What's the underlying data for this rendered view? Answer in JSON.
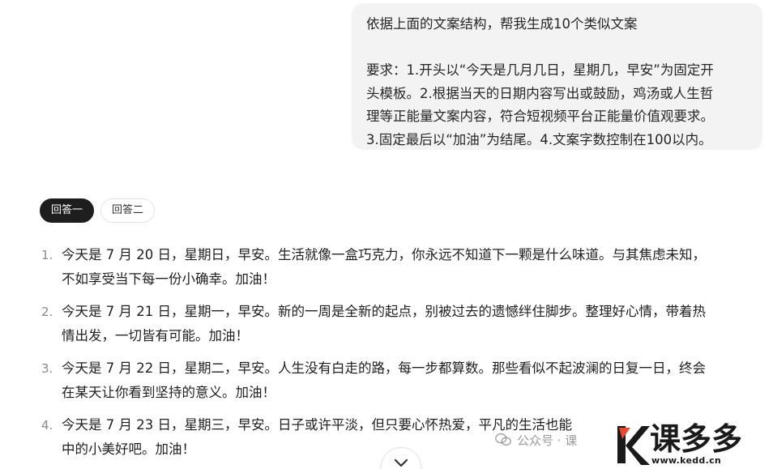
{
  "user_message": {
    "line1": "依据上面的文案结构，帮我生成10个类似文案",
    "line2": "要求：1.开头以“今天是几月几日，星期几，早安”为固定开",
    "line3": "头模板。2.根据当天的日期内容写出或鼓励，鸡汤或人生哲",
    "line4": "理等正能量文案内容，符合短视频平台正能量价值观要求。",
    "line5": "3.固定最后以“加油”为结尾。4.文案字数控制在100以内。"
  },
  "tabs": [
    {
      "label": "回答一",
      "active": true
    },
    {
      "label": "回答二",
      "active": false
    }
  ],
  "answers": [
    {
      "num": "1.",
      "line1": "今天是 7 月 20 日，星期日，早安。生活就像一盒巧克力，你永远不知道下一颗是什么味道。与其焦虑未知，",
      "line2": "不如享受当下每一份小确幸。加油！"
    },
    {
      "num": "2.",
      "line1": "今天是 7 月 21 日，星期一，早安。新的一周是全新的起点，别被过去的遗憾绊住脚步。整理好心情，带着热",
      "line2": "情出发，一切皆有可能。加油！"
    },
    {
      "num": "3.",
      "line1": "今天是 7 月 22 日，星期二，早安。人生没有白走的路，每一步都算数。那些看似不起波澜的日复一日，终会",
      "line2": "在某天让你看到坚持的意义。加油！"
    },
    {
      "num": "4.",
      "line1": "今天是 7 月 23 日，星期三，早安。日子或许平淡，但只要心怀热爱，平凡的生活也能",
      "line2": "中的小美好吧。加油！"
    }
  ],
  "watermark": {
    "text": "公众号 · 课"
  },
  "brand": {
    "logo_text": "课多多",
    "url": "www.kedd.cn",
    "icon": "k-logo-icon",
    "accent_color": "#1a1a1a",
    "highlight_color": "#e8492c"
  },
  "scroll_button": {
    "icon": "chevron-down-icon"
  }
}
